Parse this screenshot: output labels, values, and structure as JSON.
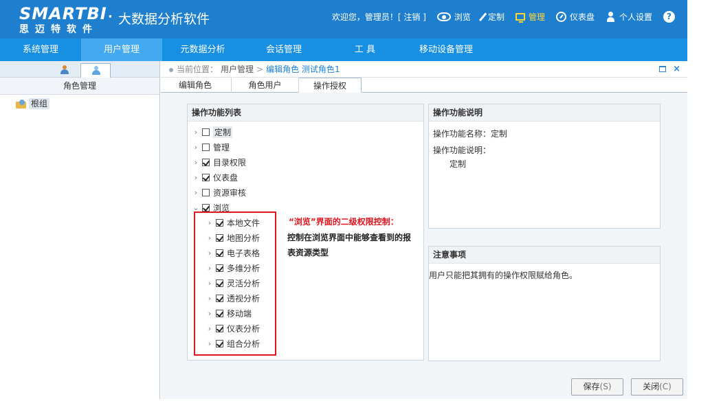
{
  "header": {
    "logo_main": "SMARTBI",
    "logo_sub": "思迈特软件",
    "logo_dot": "·",
    "app_name": "大数据分析软件",
    "welcome": "欢迎您，管理员！[ 注销 ]",
    "links": [
      {
        "label": "浏览",
        "icon": "eye-icon"
      },
      {
        "label": "定制",
        "icon": "pencil-icon"
      },
      {
        "label": "管理",
        "icon": "monitor-icon",
        "active": true
      },
      {
        "label": "仪表盘",
        "icon": "gauge-icon"
      },
      {
        "label": "个人设置",
        "icon": "person-icon"
      }
    ],
    "help": "?"
  },
  "nav": [
    "系统管理",
    "用户管理",
    "元数据分析",
    "会话管理",
    "工 具",
    "移动设备管理"
  ],
  "nav_active": 1,
  "left": {
    "title": "角色管理",
    "root": "根组"
  },
  "breadcrumb": {
    "label": "当前位置：",
    "path1": "用户管理",
    "sep": ">",
    "current": "编辑角色 测试角色1"
  },
  "tabs": [
    "编辑角色",
    "角色用户",
    "操作授权"
  ],
  "list_panel": {
    "title": "操作功能列表",
    "items": [
      {
        "label": "定制",
        "checked": false,
        "highlight": true
      },
      {
        "label": "管理",
        "checked": false
      },
      {
        "label": "目录权限",
        "checked": true
      },
      {
        "label": "仪表盘",
        "checked": true
      },
      {
        "label": "资源审核",
        "checked": false
      },
      {
        "label": "浏览",
        "checked": true,
        "expanded": true
      }
    ],
    "children": [
      {
        "label": "本地文件",
        "checked": true
      },
      {
        "label": "地图分析",
        "checked": true
      },
      {
        "label": "电子表格",
        "checked": true
      },
      {
        "label": "多维分析",
        "checked": true
      },
      {
        "label": "灵活分析",
        "checked": true
      },
      {
        "label": "透视分析",
        "checked": true
      },
      {
        "label": "移动端",
        "checked": true
      },
      {
        "label": "仪表分析",
        "checked": true
      },
      {
        "label": "组合分析",
        "checked": true
      }
    ],
    "annotation_title": "“浏览”界面的二级权限控制：",
    "annotation_body": "控制在浏览界面中能够查看到的报表资源类型"
  },
  "desc_panel": {
    "title": "操作功能说明",
    "name_line": "操作功能名称：定制",
    "desc_label": "操作功能说明：",
    "desc_value": "定制"
  },
  "note_panel": {
    "title": "注意事项",
    "text": "用户只能把其拥有的操作权限赋给角色。"
  },
  "buttons": {
    "save": "保存",
    "save_key": "(S)",
    "close": "关闭",
    "close_key": "(C)"
  }
}
